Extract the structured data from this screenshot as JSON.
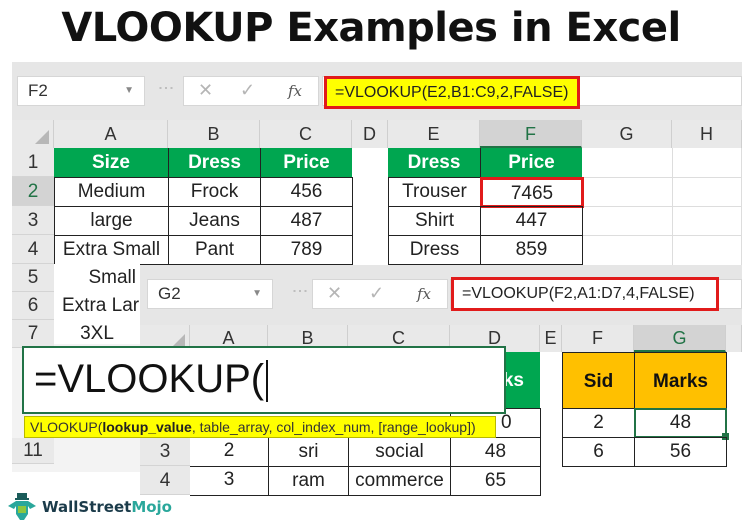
{
  "title": "VLOOKUP Examples in Excel",
  "sheet1": {
    "name_box": "F2",
    "name_box_caret": "▼",
    "cancel_icon": "✕",
    "enter_icon": "✓",
    "fx_icon": "fx",
    "formula": "=VLOOKUP(E2,B1:C9,2,FALSE)",
    "columns": [
      "A",
      "B",
      "C",
      "D",
      "E",
      "F",
      "G",
      "H"
    ],
    "selected_column": "F",
    "rows": [
      "1",
      "2",
      "3",
      "4",
      "5",
      "6",
      "7"
    ],
    "table1": {
      "headers": [
        "Size",
        "Dress",
        "Price"
      ],
      "rows": [
        [
          "Medium",
          "Frock",
          "456"
        ],
        [
          "large",
          "Jeans",
          "487"
        ],
        [
          "Extra Small",
          "Pant",
          "789"
        ]
      ],
      "extra_sizes": [
        "Small",
        "Extra Lar",
        "3XL"
      ]
    },
    "table2": {
      "headers": [
        "Dress",
        "Price"
      ],
      "rows": [
        [
          "Trouser",
          "7465"
        ],
        [
          "Shirt",
          "447"
        ],
        [
          "Dress",
          "859"
        ]
      ]
    },
    "row_11": "11"
  },
  "sheet2": {
    "name_box": "G2",
    "name_box_caret": "▼",
    "cancel_icon": "✕",
    "enter_icon": "✓",
    "fx_icon": "fx",
    "formula": "=VLOOKUP(F2,A1:D7,4,FALSE)",
    "columns": [
      "A",
      "B",
      "C",
      "D",
      "E",
      "F",
      "G"
    ],
    "selected_column": "G",
    "rows": [
      "3",
      "4"
    ],
    "d_header_partial": "ks",
    "d_row2_partial": "0",
    "table_rows": [
      [
        "2",
        "sri",
        "social",
        "48"
      ],
      [
        "3",
        "ram",
        "commerce",
        "65"
      ]
    ],
    "lookup_table": {
      "headers": [
        "Sid",
        "Marks"
      ],
      "rows": [
        [
          "2",
          "48"
        ],
        [
          "6",
          "56"
        ]
      ]
    }
  },
  "editor": {
    "text": "=VLOOKUP(",
    "tooltip_fn": "VLOOKUP(",
    "tooltip_arg_bold": "lookup_value",
    "tooltip_rest": ", table_array, col_index_num, [range_lookup])"
  },
  "brand": {
    "name_part1": "WallStreet",
    "name_part2": "Mojo"
  }
}
